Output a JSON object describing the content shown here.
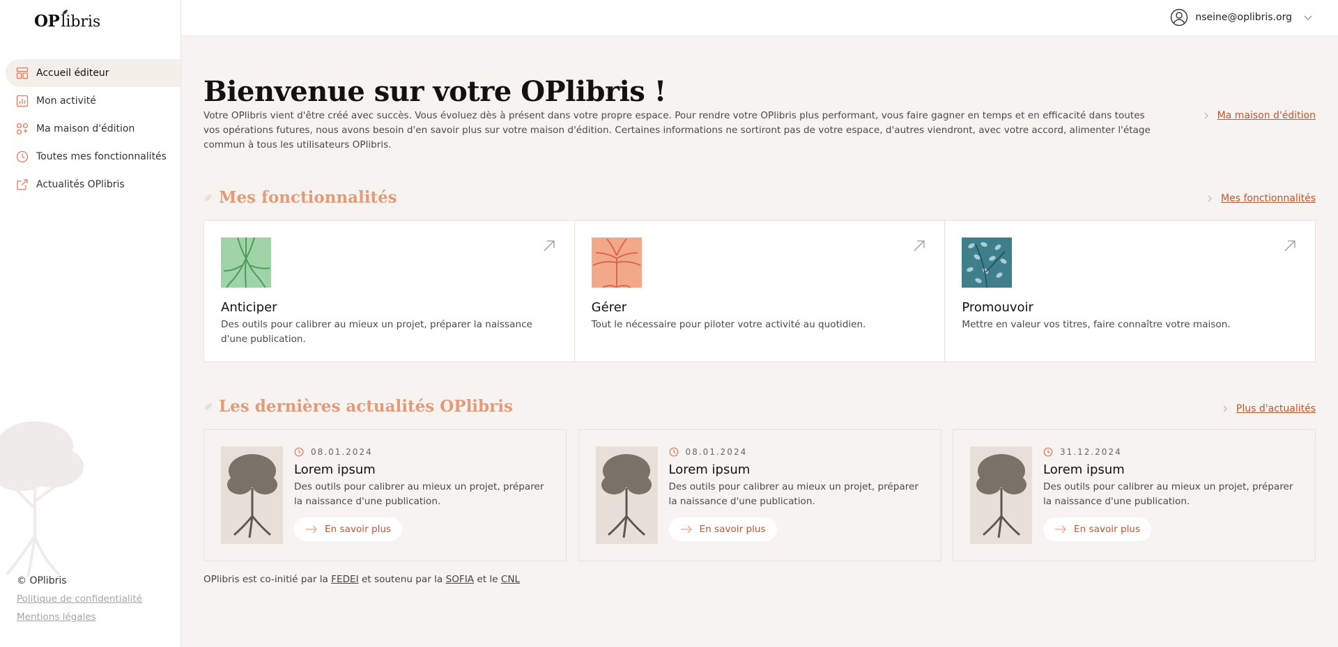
{
  "brand": {
    "op": "OP",
    "libris": "libris"
  },
  "user": {
    "email": "nseine@oplibris.org"
  },
  "sidebar": {
    "items": [
      {
        "label": "Accueil éditeur",
        "icon": "dashboard-icon",
        "active": true
      },
      {
        "label": "Mon activité",
        "icon": "chart-icon",
        "active": false
      },
      {
        "label": "Ma maison d'édition",
        "icon": "house-icon",
        "active": false
      },
      {
        "label": "Toutes mes fonctionnalités",
        "icon": "clock-icon",
        "active": false
      },
      {
        "label": "Actualités OPlibris",
        "icon": "external-link-icon",
        "active": false
      }
    ],
    "copyright": "© OPlibris",
    "privacy": "Politique de confidentialité",
    "legal": "Mentions légales"
  },
  "main": {
    "title": "Bienvenue sur votre OPlibris !",
    "intro": "Votre OPlibris vient d'être créé avec succès. Vous évoluez dès à présent dans votre propre espace. Pour rendre votre OPlibris plus performant, vous faire gagner en temps et en efficacité dans toutes vos opérations futures, nous avons besoin d'en savoir plus sur votre maison d'édition. Certaines informations ne sortiront pas de votre espace, d'autres viendront, avec votre accord, alimenter l'étage commun à tous les utilisateurs OPlibris.",
    "intro_link": "Ma maison d'édition",
    "features_title": "Mes fonctionnalités",
    "features_link": "Mes fonctionnalités",
    "features": [
      {
        "title": "Anticiper",
        "desc": "Des outils pour calibrer au mieux un projet, préparer la naissance d'une publication.",
        "color": "#9fd4a8"
      },
      {
        "title": "Gérer",
        "desc": "Tout le nécessaire pour piloter votre activité au quotidien.",
        "color": "#f2a98a"
      },
      {
        "title": "Promouvoir",
        "desc": "Mettre en valeur vos titres, faire connaître votre maison.",
        "color": "#3f7f8c"
      }
    ],
    "news_title": "Les dernières actualités OPlibris",
    "news_link": "Plus d'actualités",
    "news": [
      {
        "date": "08.01.2024",
        "title": "Lorem ipsum",
        "desc": "Des outils pour calibrer au mieux un projet, préparer la naissance d'une publication.",
        "cta": "En savoir plus"
      },
      {
        "date": "08.01.2024",
        "title": "Lorem ipsum",
        "desc": "Des outils pour calibrer au mieux un projet, préparer la naissance d'une publication.",
        "cta": "En savoir plus"
      },
      {
        "date": "31.12.2024",
        "title": "Lorem ipsum",
        "desc": "Des outils pour calibrer au mieux un projet, préparer la naissance d'une publication.",
        "cta": "En savoir plus"
      }
    ],
    "footer": {
      "part1": "OPlibris est co-initié par la",
      "fedei": "FEDEI",
      "part2": "et soutenu par la",
      "sofia": "SOFIA",
      "part3": "et le",
      "cnl": "CNL"
    }
  },
  "colors": {
    "accent": "#c0562f",
    "section": "#e59a78",
    "background": "#f7f3f0"
  }
}
